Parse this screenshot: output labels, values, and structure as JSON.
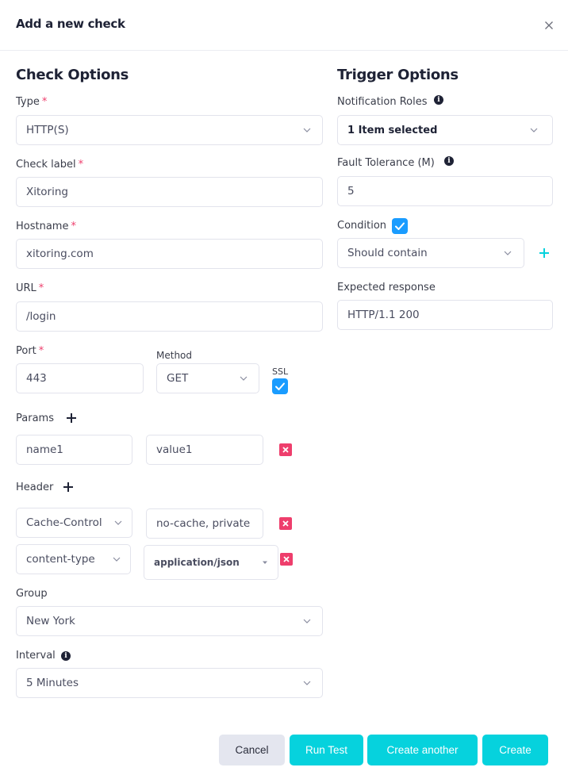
{
  "modal": {
    "title": "Add a new check",
    "close_icon": "close-icon"
  },
  "check_options": {
    "title": "Check Options",
    "type": {
      "label": "Type",
      "required": "*",
      "value": "HTTP(S)"
    },
    "check_label": {
      "label": "Check label",
      "required": "*",
      "value": "Xitoring"
    },
    "hostname": {
      "label": "Hostname",
      "required": "*",
      "value": "xitoring.com"
    },
    "url": {
      "label": "URL",
      "required": "*",
      "value": "/login"
    },
    "port": {
      "label": "Port",
      "required": "*",
      "value": "443"
    },
    "method": {
      "label": "Method",
      "value": "GET"
    },
    "ssl": {
      "label": "SSL",
      "checked": true
    },
    "params": {
      "label": "Params",
      "rows": [
        {
          "name": "name1",
          "value": "value1"
        }
      ]
    },
    "header": {
      "label": "Header",
      "rows": [
        {
          "name": "Cache-Control",
          "value": "no-cache, private"
        },
        {
          "name": "content-type",
          "value": "application/json"
        }
      ]
    },
    "group": {
      "label": "Group",
      "value": "New York"
    },
    "interval": {
      "label": "Interval",
      "value": "5 Minutes"
    }
  },
  "trigger_options": {
    "title": "Trigger Options",
    "notification_roles": {
      "label": "Notification Roles",
      "value": "1 Item selected"
    },
    "fault_tolerance": {
      "label": "Fault Tolerance (M)",
      "value": "5"
    },
    "condition": {
      "label": "Condition",
      "checked": true,
      "value": "Should contain"
    },
    "expected_response": {
      "label": "Expected response",
      "value": "HTTP/1.1 200"
    }
  },
  "footer": {
    "cancel": "Cancel",
    "run_test": "Run Test",
    "create_another": "Create another",
    "create": "Create"
  },
  "colors": {
    "accent": "#06d2dd",
    "checkbox": "#1a9cff",
    "danger": "#ee3e6c",
    "required": "#ee3e6c"
  }
}
